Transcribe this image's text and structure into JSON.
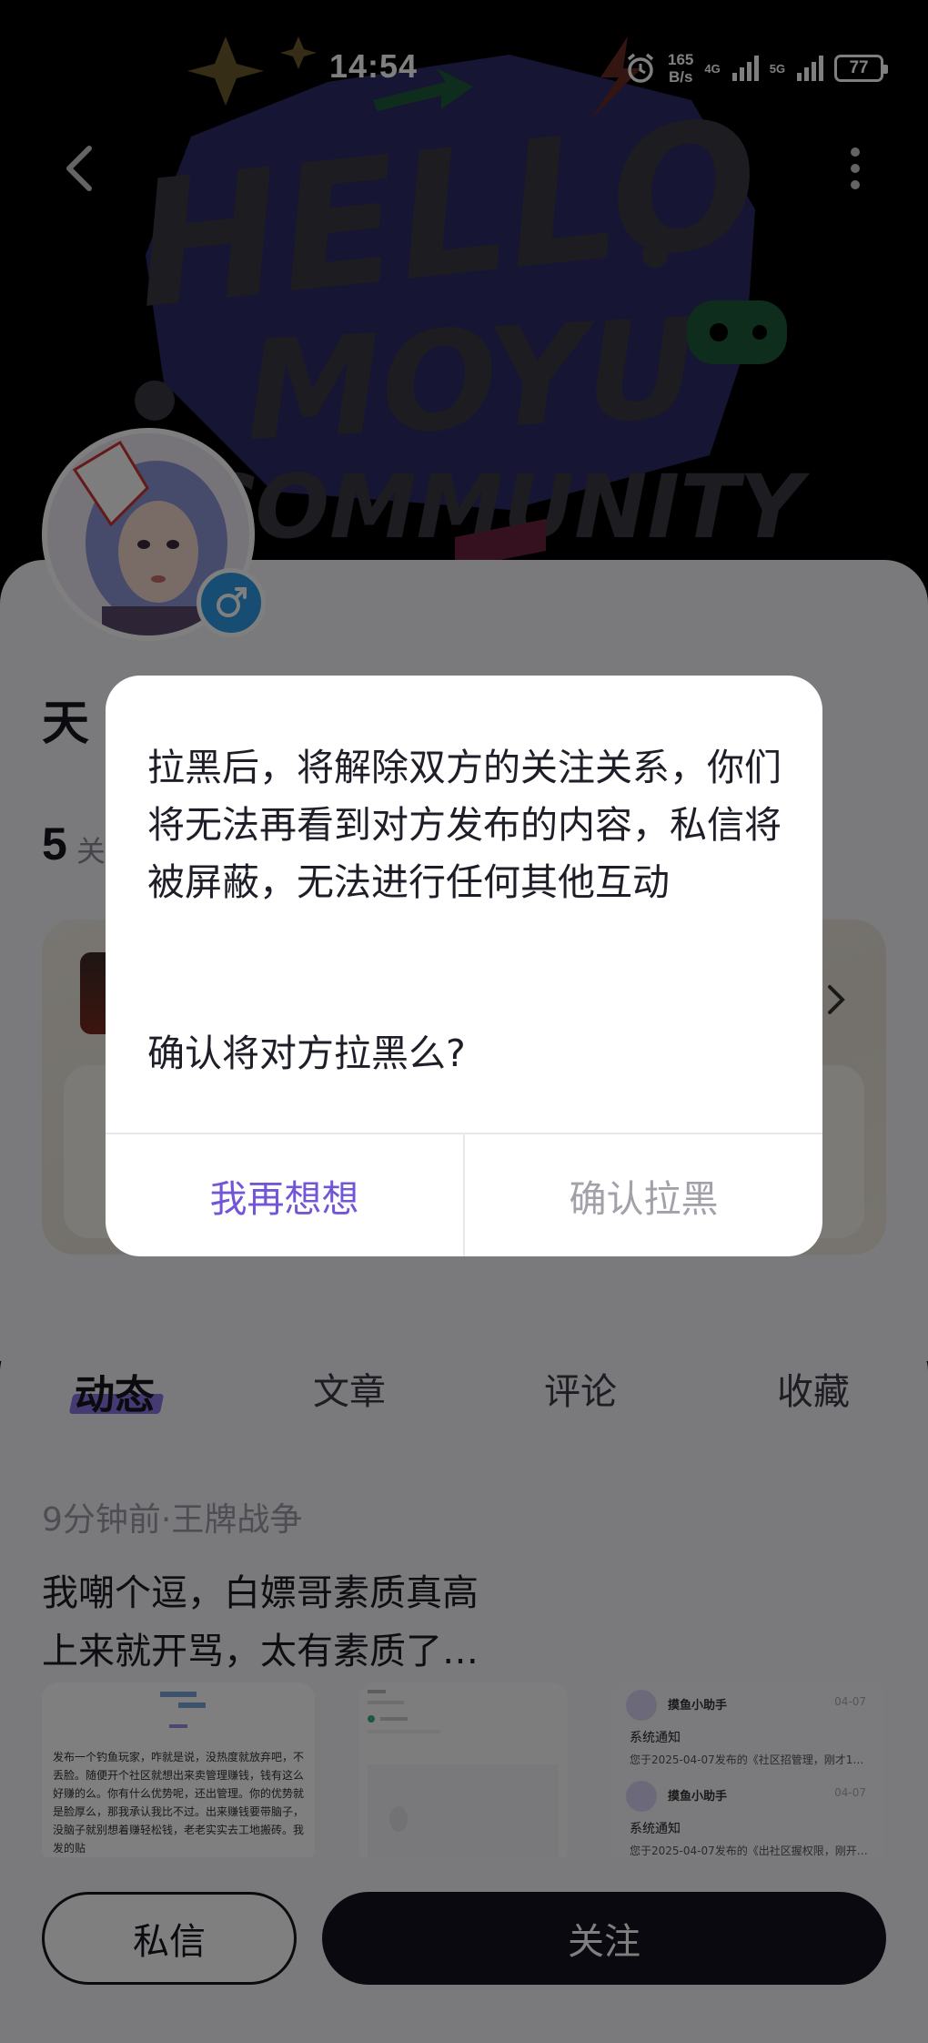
{
  "status_bar": {
    "time": "14:54",
    "net_speed_value": "165",
    "net_speed_unit": "B/s",
    "net_4g": "4G",
    "net_5g": "5G",
    "battery": "77"
  },
  "banner": {
    "line1": "HELLO",
    "line2": "MOYU",
    "line3": "COMMUNITY"
  },
  "profile": {
    "name_visible": "天",
    "follow_count": "5",
    "follow_label": "关"
  },
  "tabs": [
    {
      "label": "动态",
      "active": true
    },
    {
      "label": "文章",
      "active": false
    },
    {
      "label": "评论",
      "active": false
    },
    {
      "label": "收藏",
      "active": false
    }
  ],
  "post": {
    "meta": "9分钟前·王牌战争",
    "text": "我嘲个逗，白嫖哥素质真高\n上来就开骂，太有素质了…",
    "thumb1_text": "发布一个钓鱼玩家，咋就是说，没热度就放弃吧，不丢脸。随便开个社区就想出来卖管理赚钱，钱有这么好赚的么。你有什么优势呢，还出管理。你的优势就是脸厚么，那我承认我比不过。出来赚钱要带脑子，没脑子就别想着赚轻松钱，老老实实去工地搬砖。我发的贴",
    "notifications": [
      {
        "name": "摸鱼小助手",
        "date": "04-07",
        "title": "系统通知",
        "body": "您于2025-04-07发布的《社区招管理，刚才1…"
      },
      {
        "name": "摸鱼小助手",
        "date": "04-07",
        "title": "系统通知",
        "body": "您于2025-04-07发布的《出社区握权限，刚开…"
      }
    ]
  },
  "bottom_bar": {
    "message_label": "私信",
    "follow_label": "关注"
  },
  "dialog": {
    "message": "拉黑后，将解除双方的关注关系，你们将无法再看到对方发布的内容，私信将被屏蔽，无法进行任何其他互动",
    "question": "确认将对方拉黑么?",
    "cancel_label": "我再想想",
    "confirm_label": "确认拉黑"
  },
  "colors": {
    "accent": "#7356d6",
    "dialog_disabled_text": "#a1a1aa",
    "follow_button": "#15131f"
  }
}
